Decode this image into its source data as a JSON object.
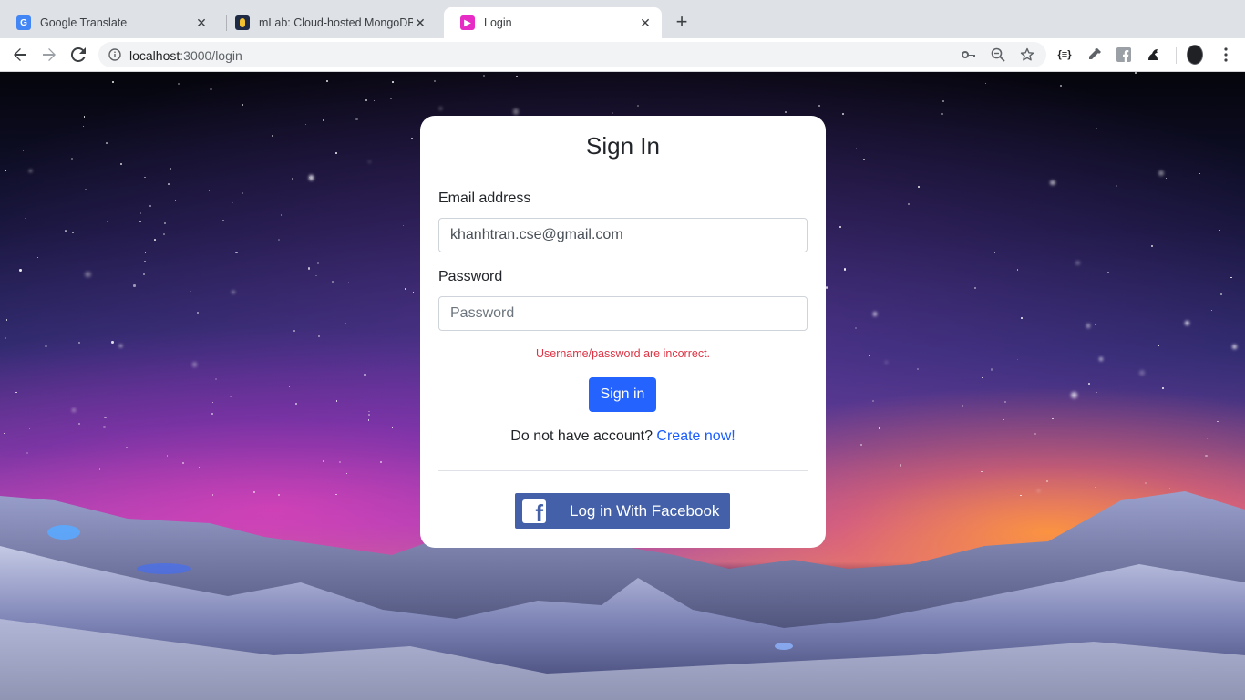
{
  "browser": {
    "tabs": [
      {
        "title": "Google Translate",
        "favicon": "google-translate-icon",
        "favicon_color": "#4285f4",
        "active": false
      },
      {
        "title": "mLab: Cloud-hosted MongoDB",
        "favicon": "mlab-icon",
        "favicon_color": "#1f2a44",
        "active": false
      },
      {
        "title": "Login",
        "favicon": "youtube-like-play-icon",
        "favicon_color": "#e62cc4",
        "active": true
      }
    ],
    "url_host": "localhost",
    "url_path": ":3000/login"
  },
  "login": {
    "title": "Sign In",
    "email_label": "Email address",
    "email_value": "khanhtran.cse@gmail.com",
    "password_label": "Password",
    "password_placeholder": "Password",
    "error": "Username/password are incorrect.",
    "signin_label": "Sign in",
    "signup_prompt": "Do not have account?",
    "signup_link": "Create now!",
    "facebook_label": "Log in With Facebook"
  },
  "colors": {
    "primary": "#2563ff",
    "link": "#1a5cff",
    "error": "#dc3545",
    "facebook": "#4460a8"
  }
}
